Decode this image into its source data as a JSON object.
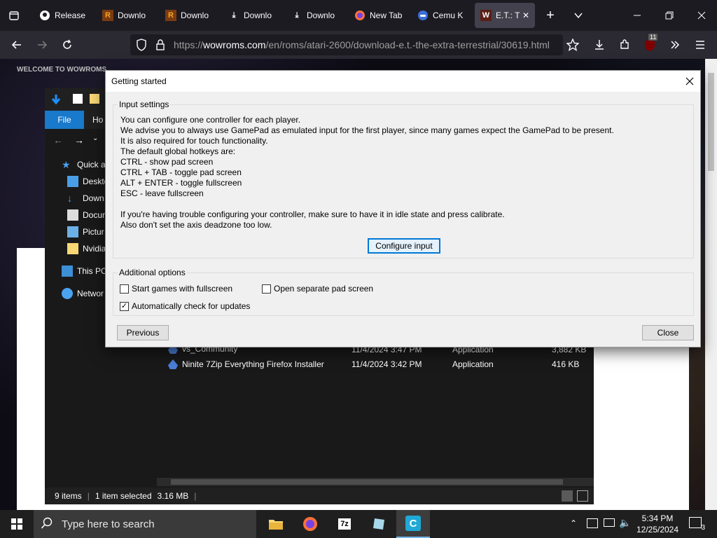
{
  "browser": {
    "tabs": [
      {
        "label": "Release",
        "icon": "github-icon"
      },
      {
        "label": "Downlo",
        "icon": "romsfun-icon"
      },
      {
        "label": "Downlo",
        "icon": "romsfun-icon"
      },
      {
        "label": "Downlo",
        "icon": "download-icon"
      },
      {
        "label": "Downlo",
        "icon": "download-icon"
      },
      {
        "label": "New Tab",
        "icon": "firefox-icon"
      },
      {
        "label": "Cemu K",
        "icon": "gamepad-icon"
      },
      {
        "label": "E.T.: T",
        "icon": "wowroms-icon"
      }
    ],
    "url_prefix": "https://",
    "url_domain": "wowroms.com",
    "url_path": "/en/roms/atari-2600/download-e.t.-the-extra-terrestrial/30619.html",
    "extensions_badge": "11"
  },
  "site": {
    "welcome": "WELCOME TO WOWROMS"
  },
  "explorer": {
    "ribbon": {
      "file": "File",
      "home": "Ho"
    },
    "sidebar": [
      {
        "label": "Quick a",
        "icon": "star-icon"
      },
      {
        "label": "Deskto",
        "icon": "desktop-icon"
      },
      {
        "label": "Down",
        "icon": "download-icon"
      },
      {
        "label": "Docur",
        "icon": "document-icon"
      },
      {
        "label": "Pictur",
        "icon": "picture-icon"
      },
      {
        "label": "Nvidia",
        "icon": "folder-icon"
      },
      {
        "label": "This PC",
        "icon": "computer-icon"
      },
      {
        "label": "Networ",
        "icon": "network-icon"
      }
    ],
    "files": [
      {
        "name": "vs_Community",
        "date": "11/4/2024 3:47 PM",
        "type": "Application",
        "size": "3,882 KB"
      },
      {
        "name": "Ninite 7Zip Everything Firefox Installer",
        "date": "11/4/2024 3:42 PM",
        "type": "Application",
        "size": "416 KB"
      }
    ],
    "status": {
      "count": "9 items",
      "selected": "1 item selected",
      "size": "3.16 MB"
    }
  },
  "dialog": {
    "title": "Getting started",
    "input_settings": {
      "legend": "Input settings",
      "lines": [
        "You can configure one controller for each player.",
        "We advise you to always use GamePad as emulated input for the first player, since many games expect the GamePad to be present.",
        "It is also required for touch functionality.",
        "The default global hotkeys are:",
        "CTRL - show pad screen",
        "CTRL + TAB - toggle pad screen",
        "ALT + ENTER - toggle fullscreen",
        "ESC - leave fullscreen",
        "If you're having trouble configuring your controller, make sure to have it in idle state and press calibrate.",
        "Also don't set the axis deadzone too low."
      ],
      "configure_button": "Configure input"
    },
    "additional_options": {
      "legend": "Additional options",
      "start_fullscreen": {
        "label": "Start games with fullscreen",
        "checked": false
      },
      "separate_pad": {
        "label": "Open separate pad screen",
        "checked": false
      },
      "auto_update": {
        "label": "Automatically check for updates",
        "checked": true
      }
    },
    "previous_button": "Previous",
    "close_button": "Close"
  },
  "taskbar": {
    "search_placeholder": "Type here to search",
    "time": "5:34 PM",
    "date": "12/25/2024",
    "notification_count": "3"
  },
  "colors": {
    "accent": "#0078d7",
    "explorer_file_tab": "#1979ca",
    "browser_bg": "#1c1b22"
  }
}
